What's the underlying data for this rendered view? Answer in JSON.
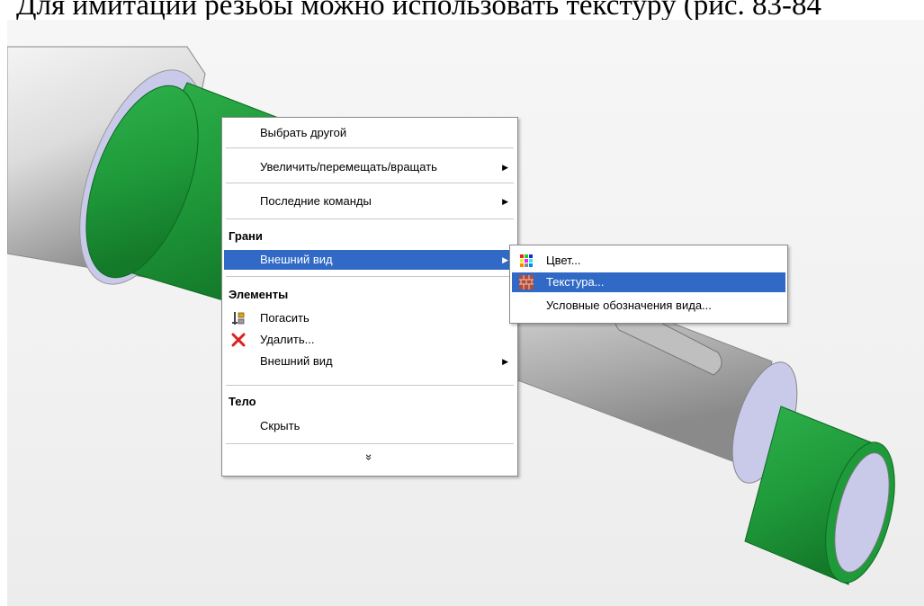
{
  "document": {
    "caption": "Для имитации резьбы можно использовать текстуру (рис. 83-84"
  },
  "context_menu": {
    "items": [
      {
        "label": "Выбрать другой"
      },
      {
        "label": "Увеличить/перемещать/вращать",
        "has_submenu": true
      },
      {
        "label": "Последние команды",
        "has_submenu": true
      }
    ],
    "faces_section": {
      "header": "Грани",
      "appearance": "Внешний вид"
    },
    "features_section": {
      "header": "Элементы",
      "suppress": "Погасить",
      "delete": "Удалить...",
      "appearance": "Внешний вид"
    },
    "body_section": {
      "header": "Тело",
      "hide": "Скрыть"
    },
    "more": "»"
  },
  "submenu": {
    "items": [
      {
        "label": "Цвет...",
        "icon": "color-palette-icon"
      },
      {
        "label": "Текстура...",
        "icon": "texture-brick-icon",
        "selected": true
      },
      {
        "label": "Условные обозначения вида...",
        "icon": null
      }
    ]
  },
  "colors": {
    "highlight": "#3169c6",
    "selected_face": "#1e9a3a",
    "shaft_grey": "#c8c8c8",
    "end_face": "#c9c9ea"
  }
}
